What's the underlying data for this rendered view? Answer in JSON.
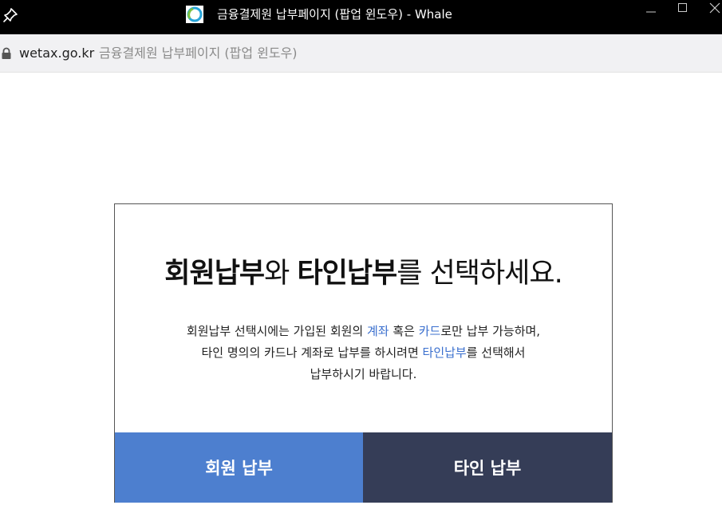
{
  "window": {
    "title": "금융결제원 납부페이지 (팝업 윈도우) - Whale",
    "icons": [
      "pin-icon",
      "whale-logo-icon",
      "minimize-icon",
      "maximize-icon",
      "close-icon"
    ]
  },
  "addressbar": {
    "domain": "wetax.go.kr",
    "page_title": "금융결제원 납부페이지 (팝업 윈도우)",
    "icon": "lock-icon"
  },
  "card": {
    "headline": {
      "part1": "회원납부",
      "part2": "와 ",
      "part3": "타인납부",
      "part4": "를 선택하세요."
    },
    "description": {
      "line1": {
        "a": "회원납부 선택시에는 가입된 회원의 ",
        "b": "계좌",
        "c": " 혹은 ",
        "d": "카드",
        "e": "로만 납부 가능하며,"
      },
      "line2": {
        "a": "타인 명의의 카드나 계좌로 납부를 하시려면 ",
        "b": "타인납부",
        "c": "를 선택해서"
      },
      "line3": "납부하시기 바랍니다."
    },
    "buttons": {
      "member": "회원 납부",
      "other": "타인 납부"
    }
  },
  "colors": {
    "titlebar": "#000000",
    "highlight": "#3a6fce",
    "member_button": "#4d7fcf",
    "other_button": "#353d57"
  }
}
